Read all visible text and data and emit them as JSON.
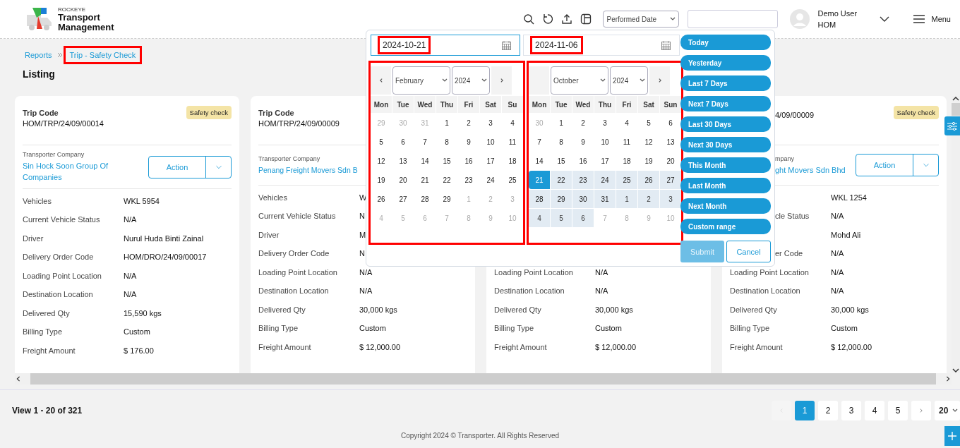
{
  "header": {
    "brand": "ROCKEYE",
    "title": "Transport Management",
    "date_filter": "Performed Date",
    "user": {
      "name": "Demo User",
      "branch": "HOM"
    },
    "menu": "Menu"
  },
  "breadcrumb": [
    {
      "label": "Reports",
      "highlighted": false
    },
    {
      "label": "Trip - Safety Check",
      "highlighted": true
    }
  ],
  "page_title": "Listing",
  "cards": [
    {
      "trip_code_label": "Trip Code",
      "trip_code": "HOM/TRP/24/09/00014",
      "badge": "Safety check",
      "company_label": "Transporter Company",
      "company": "Sin Hock Soon Group Of Companies",
      "action": "Action",
      "rows": [
        {
          "label": "Vehicles",
          "value": "WKL 5954"
        },
        {
          "label": "Current Vehicle Status",
          "value": "N/A"
        },
        {
          "label": "Driver",
          "value": "Nurul Huda Binti Zainal"
        },
        {
          "label": "Delivery Order Code",
          "value": "HOM/DRO/24/09/00017"
        },
        {
          "label": "Loading Point Location",
          "value": "N/A"
        },
        {
          "label": "Destination Location",
          "value": "N/A"
        },
        {
          "label": "Delivered Qty",
          "value": "15,590 kgs"
        },
        {
          "label": "Billing Type",
          "value": "Custom"
        },
        {
          "label": "Freight Amount",
          "value": "$ 176.00"
        }
      ]
    },
    {
      "trip_code_label": "Trip Code",
      "trip_code": "HOM/TRP/24/09/00009",
      "company_label": "Transporter Company",
      "company": "Penang Freight Movers Sdn B",
      "rows": [
        {
          "label": "Vehicles",
          "value": "W"
        },
        {
          "label": "Current Vehicle Status",
          "value": "N"
        },
        {
          "label": "Driver",
          "value": "M"
        },
        {
          "label": "Delivery Order Code",
          "value": "N"
        },
        {
          "label": "Loading Point Location",
          "value": "N/A"
        },
        {
          "label": "Destination Location",
          "value": "N/A"
        },
        {
          "label": "Delivered Qty",
          "value": "30,000 kgs"
        },
        {
          "label": "Billing Type",
          "value": "Custom"
        },
        {
          "label": "Freight Amount",
          "value": "$ 12,000.00"
        }
      ]
    },
    {
      "rows": [
        {
          "label": "Loading Point Location",
          "value": "N/A"
        },
        {
          "label": "Destination Location",
          "value": "N/A"
        },
        {
          "label": "Delivered Qty",
          "value": "30,000 kgs"
        },
        {
          "label": "Billing Type",
          "value": "Custom"
        },
        {
          "label": "Freight Amount",
          "value": "$ 12,000.00"
        }
      ]
    },
    {
      "header_cut_start": true,
      "trip_code": "4/09/00009",
      "badge": "Safety check",
      "company_label": "mpany",
      "company": "ght Movers Sdn Bhd",
      "action": "Action",
      "rows": [
        {
          "value": "WKL 1254"
        },
        {
          "label": "cle Status",
          "label_cut_start": true,
          "value": "N/A"
        },
        {
          "value": "Mohd Ali"
        },
        {
          "label": "er Code",
          "label_cut_start": true,
          "value": "N/A"
        },
        {
          "label": "Loading Point Location",
          "value": "N/A"
        },
        {
          "label": "Destination Location",
          "value": "N/A"
        },
        {
          "label": "Delivered Qty",
          "value": "30,000 kgs"
        },
        {
          "label": "Billing Type",
          "value": "Custom"
        },
        {
          "label": "Freight Amount",
          "value": "$ 12,000.00"
        }
      ]
    }
  ],
  "date_picker": {
    "start_field": {
      "value": "2024-10-21",
      "focused": true,
      "highlighted": true
    },
    "end_field": {
      "value": "2024-11-06",
      "focused": false,
      "highlighted": true
    },
    "calendars": [
      {
        "month": "February",
        "year": "2024",
        "prev": true,
        "next": true,
        "highlighted": true,
        "weekdays": [
          "Mon",
          "Tue",
          "Wed",
          "Thu",
          "Fri",
          "Sat",
          "Su"
        ],
        "weeks": [
          [
            {
              "day": "29",
              "other_month": true,
              "in_range": false,
              "selected": false
            },
            {
              "day": "30",
              "other_month": true,
              "in_range": false,
              "selected": false
            },
            {
              "day": "31",
              "other_month": true,
              "in_range": false,
              "selected": false
            },
            {
              "day": "1",
              "other_month": false,
              "in_range": false,
              "selected": false
            },
            {
              "day": "2",
              "other_month": false,
              "in_range": false,
              "selected": false
            },
            {
              "day": "3",
              "other_month": false,
              "in_range": false,
              "selected": false
            },
            {
              "day": "4",
              "other_month": false,
              "in_range": false,
              "selected": false
            }
          ],
          [
            {
              "day": "5",
              "other_month": false,
              "in_range": false,
              "selected": false
            },
            {
              "day": "6",
              "other_month": false,
              "in_range": false,
              "selected": false
            },
            {
              "day": "7",
              "other_month": false,
              "in_range": false,
              "selected": false
            },
            {
              "day": "8",
              "other_month": false,
              "in_range": false,
              "selected": false
            },
            {
              "day": "9",
              "other_month": false,
              "in_range": false,
              "selected": false
            },
            {
              "day": "10",
              "other_month": false,
              "in_range": false,
              "selected": false
            },
            {
              "day": "11",
              "other_month": false,
              "in_range": false,
              "selected": false
            }
          ],
          [
            {
              "day": "12",
              "other_month": false,
              "in_range": false,
              "selected": false
            },
            {
              "day": "13",
              "other_month": false,
              "in_range": false,
              "selected": false
            },
            {
              "day": "14",
              "other_month": false,
              "in_range": false,
              "selected": false
            },
            {
              "day": "15",
              "other_month": false,
              "in_range": false,
              "selected": false
            },
            {
              "day": "16",
              "other_month": false,
              "in_range": false,
              "selected": false
            },
            {
              "day": "17",
              "other_month": false,
              "in_range": false,
              "selected": false
            },
            {
              "day": "18",
              "other_month": false,
              "in_range": false,
              "selected": false
            }
          ],
          [
            {
              "day": "19",
              "other_month": false,
              "in_range": false,
              "selected": false
            },
            {
              "day": "20",
              "other_month": false,
              "in_range": false,
              "selected": false
            },
            {
              "day": "21",
              "other_month": false,
              "in_range": false,
              "selected": false
            },
            {
              "day": "22",
              "other_month": false,
              "in_range": false,
              "selected": false
            },
            {
              "day": "23",
              "other_month": false,
              "in_range": false,
              "selected": false
            },
            {
              "day": "24",
              "other_month": false,
              "in_range": false,
              "selected": false
            },
            {
              "day": "25",
              "other_month": false,
              "in_range": false,
              "selected": false
            }
          ],
          [
            {
              "day": "26",
              "other_month": false,
              "in_range": false,
              "selected": false
            },
            {
              "day": "27",
              "other_month": false,
              "in_range": false,
              "selected": false
            },
            {
              "day": "28",
              "other_month": false,
              "in_range": false,
              "selected": false
            },
            {
              "day": "29",
              "other_month": false,
              "in_range": false,
              "selected": false
            },
            {
              "day": "1",
              "other_month": true,
              "in_range": false,
              "selected": false
            },
            {
              "day": "2",
              "other_month": true,
              "in_range": false,
              "selected": false
            },
            {
              "day": "3",
              "other_month": true,
              "in_range": false,
              "selected": false
            }
          ],
          [
            {
              "day": "4",
              "other_month": true,
              "in_range": false,
              "selected": false
            },
            {
              "day": "5",
              "other_month": true,
              "in_range": false,
              "selected": false
            },
            {
              "day": "6",
              "other_month": true,
              "in_range": false,
              "selected": false
            },
            {
              "day": "7",
              "other_month": true,
              "in_range": false,
              "selected": false
            },
            {
              "day": "8",
              "other_month": true,
              "in_range": false,
              "selected": false
            },
            {
              "day": "9",
              "other_month": true,
              "in_range": false,
              "selected": false
            },
            {
              "day": "10",
              "other_month": true,
              "in_range": false,
              "selected": false
            }
          ]
        ]
      },
      {
        "month": "October",
        "year": "2024",
        "prev": false,
        "next": true,
        "highlighted": true,
        "weekdays": [
          "Mon",
          "Tue",
          "Wed",
          "Thu",
          "Fri",
          "Sat",
          "Sun"
        ],
        "weeks": [
          [
            {
              "day": "30",
              "other_month": true,
              "in_range": false,
              "selected": false
            },
            {
              "day": "1",
              "other_month": false,
              "in_range": false,
              "selected": false
            },
            {
              "day": "2",
              "other_month": false,
              "in_range": false,
              "selected": false
            },
            {
              "day": "3",
              "other_month": false,
              "in_range": false,
              "selected": false
            },
            {
              "day": "4",
              "other_month": false,
              "in_range": false,
              "selected": false
            },
            {
              "day": "5",
              "other_month": false,
              "in_range": false,
              "selected": false
            },
            {
              "day": "6",
              "other_month": false,
              "in_range": false,
              "selected": false
            }
          ],
          [
            {
              "day": "7",
              "other_month": false,
              "in_range": false,
              "selected": false
            },
            {
              "day": "8",
              "other_month": false,
              "in_range": false,
              "selected": false
            },
            {
              "day": "9",
              "other_month": false,
              "in_range": false,
              "selected": false
            },
            {
              "day": "10",
              "other_month": false,
              "in_range": false,
              "selected": false
            },
            {
              "day": "11",
              "other_month": false,
              "in_range": false,
              "selected": false
            },
            {
              "day": "12",
              "other_month": false,
              "in_range": false,
              "selected": false
            },
            {
              "day": "13",
              "other_month": false,
              "in_range": false,
              "selected": false
            }
          ],
          [
            {
              "day": "14",
              "other_month": false,
              "in_range": false,
              "selected": false
            },
            {
              "day": "15",
              "other_month": false,
              "in_range": false,
              "selected": false
            },
            {
              "day": "16",
              "other_month": false,
              "in_range": false,
              "selected": false
            },
            {
              "day": "17",
              "other_month": false,
              "in_range": false,
              "selected": false
            },
            {
              "day": "18",
              "other_month": false,
              "in_range": false,
              "selected": false
            },
            {
              "day": "19",
              "other_month": false,
              "in_range": false,
              "selected": false
            },
            {
              "day": "20",
              "other_month": false,
              "in_range": false,
              "selected": false
            }
          ],
          [
            {
              "day": "21",
              "other_month": false,
              "in_range": true,
              "selected": true
            },
            {
              "day": "22",
              "other_month": false,
              "in_range": true,
              "selected": false
            },
            {
              "day": "23",
              "other_month": false,
              "in_range": true,
              "selected": false
            },
            {
              "day": "24",
              "other_month": false,
              "in_range": true,
              "selected": false
            },
            {
              "day": "25",
              "other_month": false,
              "in_range": true,
              "selected": false
            },
            {
              "day": "26",
              "other_month": false,
              "in_range": true,
              "selected": false
            },
            {
              "day": "27",
              "other_month": false,
              "in_range": true,
              "selected": false
            }
          ],
          [
            {
              "day": "28",
              "other_month": false,
              "in_range": true,
              "selected": false
            },
            {
              "day": "29",
              "other_month": false,
              "in_range": true,
              "selected": false
            },
            {
              "day": "30",
              "other_month": false,
              "in_range": true,
              "selected": false
            },
            {
              "day": "31",
              "other_month": false,
              "in_range": true,
              "selected": false
            },
            {
              "day": "1",
              "other_month": true,
              "in_range": true,
              "selected": false
            },
            {
              "day": "2",
              "other_month": true,
              "in_range": true,
              "selected": false
            },
            {
              "day": "3",
              "other_month": true,
              "in_range": true,
              "selected": false
            }
          ],
          [
            {
              "day": "4",
              "other_month": true,
              "in_range": true,
              "selected": false
            },
            {
              "day": "5",
              "other_month": true,
              "in_range": true,
              "selected": false
            },
            {
              "day": "6",
              "other_month": true,
              "in_range": true,
              "selected": false
            },
            {
              "day": "7",
              "other_month": true,
              "in_range": false,
              "selected": false
            },
            {
              "day": "8",
              "other_month": true,
              "in_range": false,
              "selected": false
            },
            {
              "day": "9",
              "other_month": true,
              "in_range": false,
              "selected": false
            },
            {
              "day": "10",
              "other_month": true,
              "in_range": false,
              "selected": false
            }
          ]
        ]
      }
    ],
    "ranges": [
      {
        "label": "Today"
      },
      {
        "label": "Yesterday"
      },
      {
        "label": "Last 7 Days"
      },
      {
        "label": "Next 7 Days"
      },
      {
        "label": "Last 30 Days"
      },
      {
        "label": "Next 30 Days"
      },
      {
        "label": "This Month"
      },
      {
        "label": "Last Month"
      },
      {
        "label": "Next Month"
      },
      {
        "label": "Custom range"
      }
    ],
    "submit": {
      "label": "Submit",
      "disabled": true
    },
    "cancel": {
      "label": "Cancel"
    }
  },
  "footer": {
    "summary": "View 1 - 20 of 321",
    "pager": {
      "prev_disabled": true,
      "next_disabled": false,
      "pages": [
        {
          "label": "1",
          "selected": true
        },
        {
          "label": "2",
          "selected": false
        },
        {
          "label": "3",
          "selected": false
        },
        {
          "label": "4",
          "selected": false
        },
        {
          "label": "5",
          "selected": false
        }
      ]
    },
    "page_size": "20",
    "copyright": "Copyright 2024 © Transporter. All Rights Reserved"
  }
}
